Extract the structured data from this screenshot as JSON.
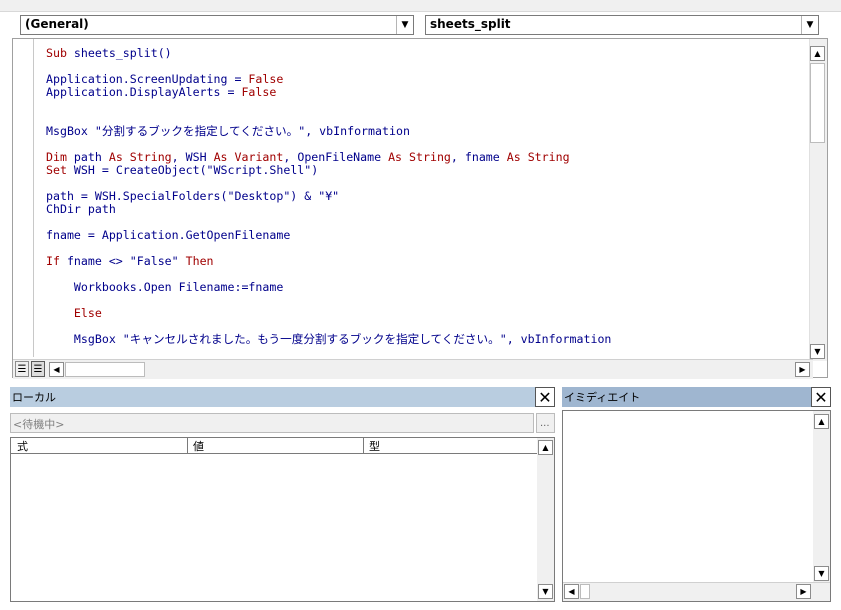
{
  "code_window": {
    "object_combo": "(General)",
    "procedure_combo": "sheets_split",
    "lines": [
      {
        "parts": [
          {
            "t": "Sub",
            "k": 1
          },
          {
            "t": " sheets_split()",
            "k": 0
          }
        ]
      },
      {
        "parts": []
      },
      {
        "parts": [
          {
            "t": "Application.ScreenUpdating = ",
            "k": 0
          },
          {
            "t": "False",
            "k": 1
          }
        ]
      },
      {
        "parts": [
          {
            "t": "Application.DisplayAlerts = ",
            "k": 0
          },
          {
            "t": "False",
            "k": 1
          }
        ]
      },
      {
        "parts": []
      },
      {
        "parts": []
      },
      {
        "parts": [
          {
            "t": "MsgBox \"分割するブックを指定してください。\", vbInformation",
            "k": 0
          }
        ]
      },
      {
        "parts": []
      },
      {
        "parts": [
          {
            "t": "Dim",
            "k": 1
          },
          {
            "t": " path ",
            "k": 0
          },
          {
            "t": "As String",
            "k": 1
          },
          {
            "t": ", WSH ",
            "k": 0
          },
          {
            "t": "As Variant",
            "k": 1
          },
          {
            "t": ", OpenFileName ",
            "k": 0
          },
          {
            "t": "As String",
            "k": 1
          },
          {
            "t": ", fname ",
            "k": 0
          },
          {
            "t": "As String",
            "k": 1
          }
        ]
      },
      {
        "parts": [
          {
            "t": "Set",
            "k": 1
          },
          {
            "t": " WSH = CreateObject(\"WScript.Shell\")",
            "k": 0
          }
        ]
      },
      {
        "parts": []
      },
      {
        "parts": [
          {
            "t": "path = WSH.SpecialFolders(\"Desktop\") & \"¥\"",
            "k": 0
          }
        ]
      },
      {
        "parts": [
          {
            "t": "ChDir path",
            "k": 0
          }
        ]
      },
      {
        "parts": []
      },
      {
        "parts": [
          {
            "t": "fname = Application.GetOpenFilename",
            "k": 0
          }
        ]
      },
      {
        "parts": []
      },
      {
        "parts": [
          {
            "t": "If",
            "k": 1
          },
          {
            "t": " fname <> \"False\" ",
            "k": 0
          },
          {
            "t": "Then",
            "k": 1
          }
        ]
      },
      {
        "parts": []
      },
      {
        "parts": [
          {
            "t": "    Workbooks.Open Filename:=fname",
            "k": 0
          }
        ]
      },
      {
        "parts": []
      },
      {
        "parts": [
          {
            "t": "    ",
            "k": 0
          },
          {
            "t": "Else",
            "k": 1
          }
        ]
      },
      {
        "parts": []
      },
      {
        "parts": [
          {
            "t": "    MsgBox \"キャンセルされました。もう一度分割するブックを指定してください。\", vbInformation",
            "k": 0
          }
        ]
      }
    ]
  },
  "locals": {
    "title": "ローカル",
    "status": "<待機中>",
    "more_button": "...",
    "columns": [
      "式",
      "値",
      "型"
    ]
  },
  "immediate": {
    "title": "イミディエイト"
  },
  "icons": {
    "close": "✕",
    "dropdown": "▼",
    "up": "▲",
    "down": "▼",
    "left": "◀",
    "right": "▶"
  },
  "colors": {
    "keyword": "#a00000",
    "identifier": "#00008b",
    "panel_header": "#b9cde0"
  }
}
